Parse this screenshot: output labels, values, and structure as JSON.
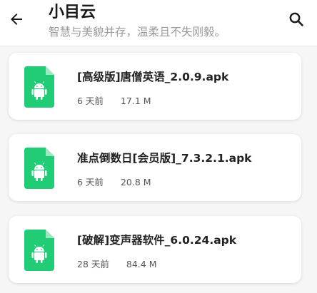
{
  "header": {
    "title": "小目云",
    "subtitle": "智慧与美貌并存，温柔且不失刚毅。"
  },
  "colors": {
    "accent": "#22cc77",
    "background": "#f6f6f6"
  },
  "files": [
    {
      "name": "[高级版]唐僧英语_2.0.9.apk",
      "time": "6 天前",
      "size": "17.1 M"
    },
    {
      "name": "准点倒数日[会员版]_7.3.2.1.apk",
      "time": "6 天前",
      "size": "20.8 M"
    },
    {
      "name": "[破解]变声器软件_6.0.24.apk",
      "time": "28 天前",
      "size": "84.4 M"
    }
  ]
}
